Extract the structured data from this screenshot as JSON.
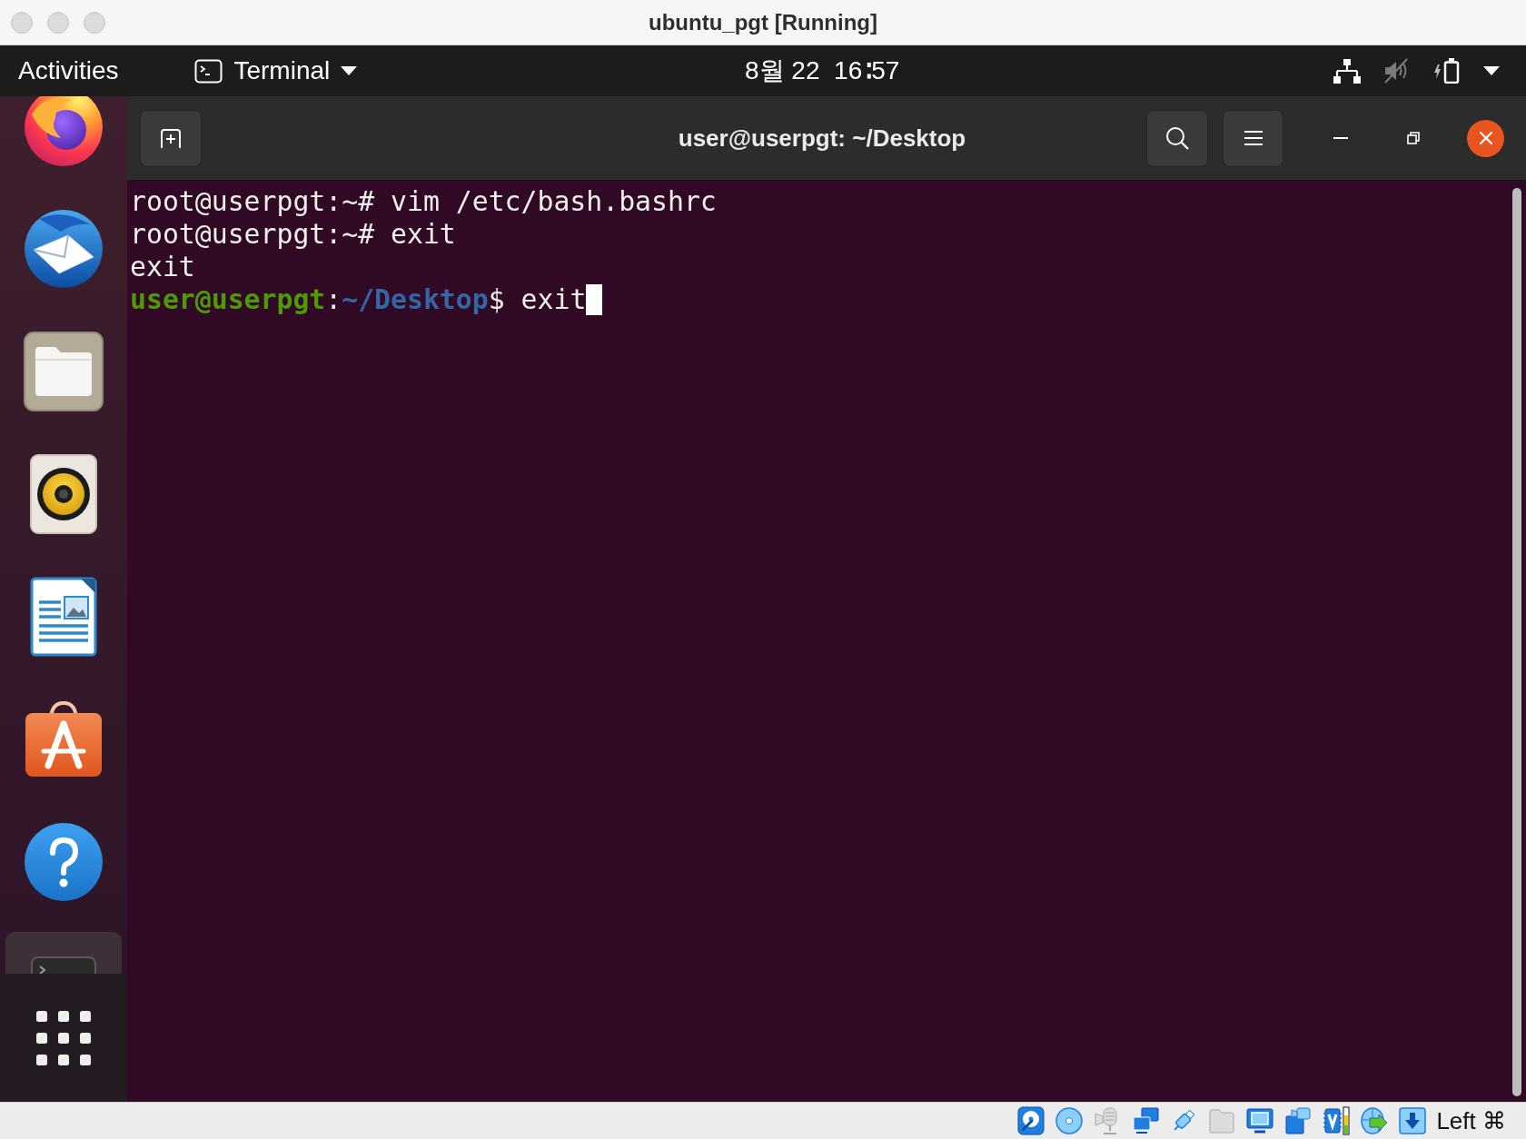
{
  "window": {
    "title": "ubuntu_pgt [Running]"
  },
  "top_bar": {
    "activities": "Activities",
    "app_menu": "Terminal",
    "clock": "8월 22  16∶57"
  },
  "dock": {
    "items": [
      {
        "selected": false
      },
      {
        "selected": false
      },
      {
        "selected": false
      },
      {
        "selected": false
      },
      {
        "selected": false
      },
      {
        "selected": false
      },
      {
        "selected": false
      },
      {
        "selected": true
      }
    ]
  },
  "terminal": {
    "title": "user@userpgt: ~/Desktop",
    "lines": [
      {
        "segments": [
          {
            "kind": "plain",
            "text": "root@userpgt:~# vim /etc/bash.bashrc"
          }
        ]
      },
      {
        "segments": [
          {
            "kind": "plain",
            "text": "root@userpgt:~# exit"
          }
        ]
      },
      {
        "segments": [
          {
            "kind": "plain",
            "text": "exit"
          }
        ]
      },
      {
        "segments": [
          {
            "kind": "user",
            "text": "user@userpgt"
          },
          {
            "kind": "plain",
            "text": ":"
          },
          {
            "kind": "path",
            "text": "~/Desktop"
          },
          {
            "kind": "plain",
            "text": "$ exit"
          }
        ]
      }
    ],
    "cursor": true
  },
  "status_bar": {
    "indicators": [
      {
        "disabled": false
      },
      {
        "disabled": false
      },
      {
        "disabled": true
      },
      {
        "disabled": false
      },
      {
        "disabled": false
      },
      {
        "disabled": true
      },
      {
        "disabled": false
      },
      {
        "disabled": false
      },
      {
        "disabled": false
      },
      {
        "disabled": false
      },
      {
        "disabled": false
      }
    ],
    "host_key": "Left ⌘"
  }
}
